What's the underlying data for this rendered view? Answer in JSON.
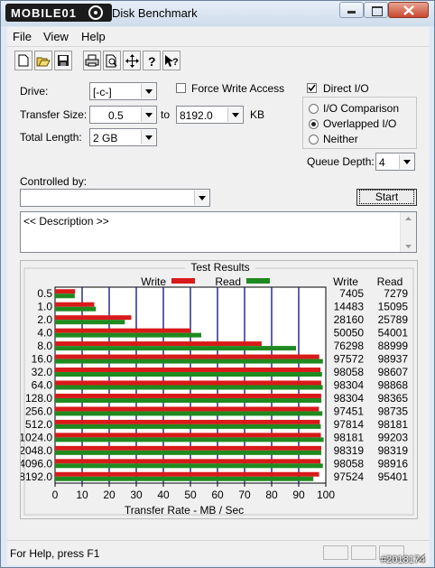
{
  "window": {
    "logo_text": "MOBILE01",
    "title": "Disk Benchmark"
  },
  "menu": {
    "items": [
      "File",
      "View",
      "Help"
    ]
  },
  "toolbar": {
    "icons": [
      "new-icon",
      "open-icon",
      "save-icon",
      "print-icon",
      "print-preview-icon",
      "move-icon",
      "about-icon",
      "context-help-icon"
    ]
  },
  "form": {
    "drive_label": "Drive:",
    "drive_value": "[-c-]",
    "force_write_label": "Force Write Access",
    "force_write_checked": false,
    "direct_io_label": "Direct I/O",
    "direct_io_checked": true,
    "transfer_size_label": "Transfer Size:",
    "transfer_from": "0.5",
    "to_label": "to",
    "transfer_to": "8192.0",
    "unit_label": "KB",
    "total_length_label": "Total Length:",
    "total_length_value": "2 GB",
    "io_comparison_label": "I/O Comparison",
    "overlapped_io_label": "Overlapped I/O",
    "neither_label": "Neither",
    "selected_mode": "Overlapped I/O",
    "queue_depth_label": "Queue Depth:",
    "queue_depth_value": "4",
    "controlled_by_label": "Controlled by:",
    "controlled_by_value": "",
    "start_label": "Start",
    "description_text": "<< Description >>"
  },
  "results": {
    "title": "Test Results",
    "write_col": "Write",
    "read_col": "Read",
    "legend_write": "Write",
    "legend_read": "Read"
  },
  "chart_data": {
    "type": "bar",
    "orientation": "horizontal",
    "categories": [
      "0.5",
      "1.0",
      "2.0",
      "4.0",
      "8.0",
      "16.0",
      "32.0",
      "64.0",
      "128.0",
      "256.0",
      "512.0",
      "1024.0",
      "2048.0",
      "4096.0",
      "8192.0"
    ],
    "series": [
      {
        "name": "Write",
        "color": "#d91a1a",
        "values": [
          7405,
          14483,
          28160,
          50050,
          76298,
          97572,
          98058,
          98304,
          98304,
          97451,
          97814,
          98181,
          98319,
          98058,
          97524
        ]
      },
      {
        "name": "Read",
        "color": "#1f8a1f",
        "values": [
          7279,
          15095,
          25789,
          54001,
          88999,
          98937,
          98607,
          98868,
          98365,
          98735,
          98181,
          99203,
          98319,
          98916,
          95401
        ]
      }
    ],
    "xlabel": "Transfer Rate - MB / Sec",
    "xticks": [
      "0",
      "10",
      "20",
      "30",
      "40",
      "50",
      "60",
      "70",
      "80",
      "90",
      "100"
    ],
    "xlim": [
      0,
      100
    ],
    "grid": true,
    "plot_bg": "#ffffff",
    "grid_color": "#1c1c8c",
    "legend": "top"
  },
  "status": {
    "text": "For Help, press F1",
    "watermark": "#2018174"
  }
}
